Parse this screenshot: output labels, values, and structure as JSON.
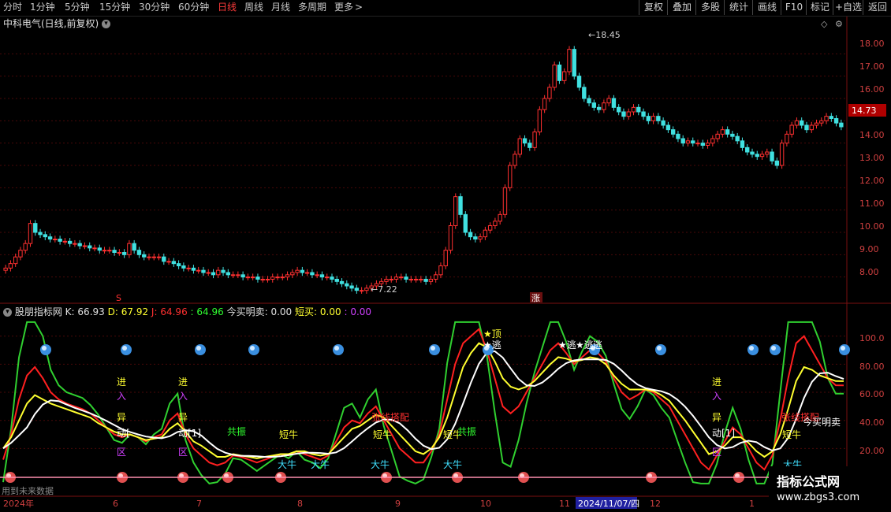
{
  "toolbar": {
    "left": [
      "分时",
      "1分钟",
      "5分钟",
      "15分钟",
      "30分钟",
      "60分钟",
      "日线",
      "周线",
      "月线",
      "多周期",
      "更多"
    ],
    "active": "日线",
    "more_arrow": ">",
    "right": [
      "复权",
      "叠加",
      "多股",
      "统计",
      "画线",
      "F10",
      "标记",
      "+自选",
      "返回"
    ]
  },
  "main_panel": {
    "stock_title": "中科电气(日线,前复权)",
    "high_label": "18.45",
    "low_label": "7.22",
    "current_price": "14.73",
    "marker_s": "S",
    "marker_zhang": "涨",
    "price_ticks": [
      "18.00",
      "17.00",
      "16.00",
      "15.00",
      "14.00",
      "13.00",
      "12.00",
      "11.00",
      "10.00",
      "9.00",
      "8.00"
    ]
  },
  "indicator_panel": {
    "name": "股朋指标网",
    "k_label": "K:",
    "k_value": "66.93",
    "d_label": "D:",
    "d_value": "67.92",
    "j_label": "J:",
    "j_value": "64.96",
    "extra_label": ":",
    "extra_value": "64.96",
    "buy_label": "今买明卖:",
    "buy_value": "0.00",
    "short_label": "短买:",
    "short_value": "0.00",
    "last_label": ":",
    "last_value": "0.00",
    "ticks": [
      "100.0",
      "80.00",
      "60.00",
      "40.00",
      "20.00"
    ],
    "labels": {
      "jin": "进",
      "ru": "入",
      "yi": "异",
      "dong": "动[1]",
      "dong2": "动[",
      "qu": "区",
      "gongzhen": "共振",
      "duanniu": "短牛",
      "daniu": "大牛",
      "zhangxian": "张线搭配",
      "ding": "★顶",
      "tao": "★逃",
      "tao_short": "逃",
      "jinmai": "今买明卖",
      "duanniu2": "短牛"
    }
  },
  "date_axis": {
    "labels": [
      "2024年",
      "6",
      "7",
      "8",
      "9",
      "10",
      "11",
      "2024/11/07/四",
      "12",
      "1"
    ]
  },
  "status_text": "用到未来数据",
  "watermark": {
    "main": "指标公式网",
    "url": "www.zbgs3.com"
  },
  "chart_data": {
    "type": "candlestick",
    "ylim": [
      7.0,
      19.0
    ],
    "high": 18.45,
    "low": 7.22,
    "last": 14.73,
    "closes": [
      8.4,
      8.6,
      8.9,
      9.2,
      9.5,
      10.4,
      10.0,
      9.9,
      9.8,
      9.7,
      9.7,
      9.6,
      9.6,
      9.5,
      9.5,
      9.4,
      9.4,
      9.3,
      9.3,
      9.2,
      9.2,
      9.2,
      9.1,
      9.1,
      9.0,
      9.5,
      9.2,
      9.0,
      8.9,
      8.9,
      8.9,
      8.9,
      8.7,
      8.7,
      8.6,
      8.5,
      8.4,
      8.4,
      8.3,
      8.3,
      8.2,
      8.2,
      8.1,
      8.3,
      8.2,
      8.1,
      8.1,
      8.1,
      8.0,
      8.0,
      8.0,
      7.9,
      7.9,
      7.9,
      8.0,
      8.0,
      8.0,
      8.1,
      8.2,
      8.3,
      8.2,
      8.2,
      8.1,
      8.1,
      8.0,
      8.0,
      7.9,
      7.8,
      7.7,
      7.6,
      7.5,
      7.4,
      7.4,
      7.5,
      7.6,
      7.7,
      7.8,
      7.9,
      7.9,
      8.0,
      8.0,
      7.9,
      7.9,
      7.9,
      7.9,
      7.8,
      7.9,
      8.1,
      8.5,
      9.2,
      10.3,
      11.6,
      10.8,
      10.0,
      9.8,
      9.7,
      9.8,
      10.1,
      10.3,
      10.5,
      10.8,
      12.0,
      13.0,
      13.5,
      14.2,
      14.0,
      13.8,
      14.5,
      15.5,
      16.0,
      16.5,
      17.5,
      16.8,
      17.2,
      18.2,
      17.0,
      16.5,
      16.0,
      15.8,
      15.6,
      15.5,
      15.8,
      16.0,
      15.6,
      15.4,
      15.2,
      15.4,
      15.6,
      15.4,
      15.2,
      15.0,
      15.2,
      15.0,
      14.8,
      14.6,
      14.4,
      14.2,
      14.0,
      14.1,
      14.0,
      14.0,
      13.9,
      14.0,
      14.2,
      14.4,
      14.6,
      14.4,
      14.3,
      14.1,
      13.8,
      13.6,
      13.5,
      13.4,
      13.5,
      13.6,
      13.2,
      13.0,
      14.0,
      14.4,
      14.8,
      15.0,
      14.8,
      14.6,
      14.8,
      14.9,
      15.0,
      15.2,
      15.1,
      14.9,
      14.73
    ],
    "k": [
      12,
      30,
      55,
      72,
      78,
      70,
      60,
      55,
      52,
      50,
      48,
      45,
      40,
      35,
      30,
      28,
      30,
      28,
      25,
      28,
      30,
      40,
      45,
      30,
      20,
      15,
      10,
      8,
      10,
      15,
      14,
      12,
      10,
      12,
      14,
      16,
      15,
      18,
      16,
      14,
      12,
      15,
      25,
      35,
      40,
      38,
      45,
      50,
      40,
      30,
      20,
      15,
      10,
      10,
      18,
      30,
      55,
      80,
      95,
      100,
      105,
      90,
      70,
      50,
      45,
      50,
      60,
      70,
      80,
      90,
      95,
      88,
      80,
      85,
      90,
      88,
      82,
      70,
      60,
      55,
      58,
      62,
      60,
      55,
      50,
      40,
      30,
      20,
      10,
      5,
      15,
      25,
      35,
      30,
      20,
      10,
      5,
      15,
      40,
      70,
      95,
      100,
      90,
      80,
      70,
      65,
      64.96
    ],
    "d": [
      20,
      28,
      40,
      52,
      58,
      55,
      52,
      50,
      48,
      46,
      44,
      42,
      38,
      35,
      32,
      30,
      30,
      28,
      26,
      27,
      28,
      34,
      38,
      32,
      25,
      22,
      18,
      14,
      14,
      16,
      15,
      14,
      13,
      14,
      15,
      16,
      16,
      18,
      18,
      16,
      15,
      16,
      22,
      28,
      34,
      36,
      40,
      44,
      42,
      36,
      30,
      24,
      18,
      16,
      20,
      28,
      42,
      60,
      78,
      88,
      95,
      92,
      82,
      70,
      64,
      62,
      64,
      68,
      74,
      80,
      85,
      84,
      82,
      83,
      85,
      84,
      80,
      72,
      66,
      62,
      62,
      62,
      61,
      58,
      54,
      47,
      40,
      32,
      24,
      16,
      18,
      22,
      28,
      28,
      24,
      18,
      14,
      18,
      30,
      48,
      68,
      78,
      76,
      72,
      70,
      68,
      67.92
    ]
  }
}
